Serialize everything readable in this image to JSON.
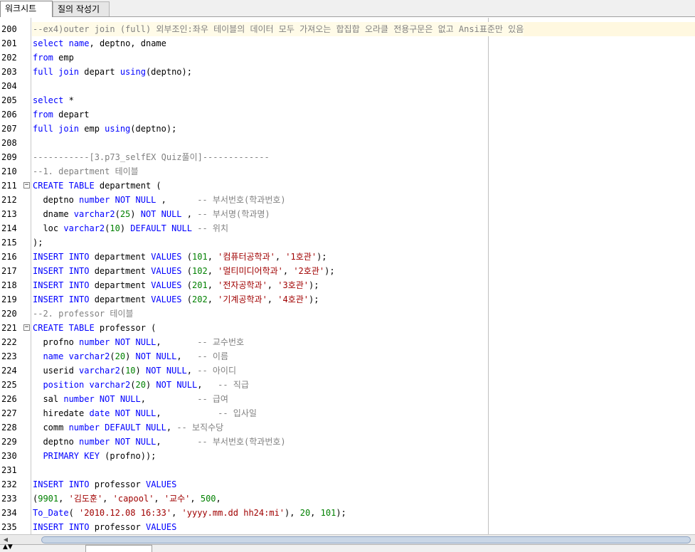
{
  "tabs": [
    {
      "label": "워크시트",
      "active": true
    },
    {
      "label": "질의 작성기",
      "active": false
    }
  ],
  "lines": [
    {
      "n": "200",
      "hl": true,
      "segs": [
        [
          "cm",
          "--ex4)outer join (full) 외부조인:좌우 테이블의 데이터 모두 가져오는 합집합 오라클 전용구문은 없고 Ansi표준만 있음"
        ]
      ]
    },
    {
      "n": "201",
      "segs": [
        [
          "kw",
          "select"
        ],
        [
          "",
          " "
        ],
        [
          "kw",
          "name"
        ],
        [
          "",
          ", deptno, dname"
        ]
      ]
    },
    {
      "n": "202",
      "segs": [
        [
          "kw",
          "from"
        ],
        [
          "",
          " emp"
        ]
      ]
    },
    {
      "n": "203",
      "segs": [
        [
          "kw",
          "full join"
        ],
        [
          "",
          " depart "
        ],
        [
          "kw",
          "using"
        ],
        [
          "",
          "(deptno);"
        ]
      ]
    },
    {
      "n": "204",
      "segs": []
    },
    {
      "n": "205",
      "segs": [
        [
          "kw",
          "select"
        ],
        [
          "",
          " *"
        ]
      ]
    },
    {
      "n": "206",
      "segs": [
        [
          "kw",
          "from"
        ],
        [
          "",
          " depart"
        ]
      ]
    },
    {
      "n": "207",
      "segs": [
        [
          "kw",
          "full join"
        ],
        [
          "",
          " emp "
        ],
        [
          "kw",
          "using"
        ],
        [
          "",
          "(deptno);"
        ]
      ]
    },
    {
      "n": "208",
      "segs": []
    },
    {
      "n": "209",
      "segs": [
        [
          "cm",
          "-----------[3.p73_selfEX Quiz풀이]-------------"
        ]
      ]
    },
    {
      "n": "210",
      "segs": [
        [
          "cm",
          "--1. department 테이블"
        ]
      ]
    },
    {
      "n": "211",
      "fold": true,
      "segs": [
        [
          "kw",
          "CREATE TABLE"
        ],
        [
          "",
          " department ("
        ]
      ]
    },
    {
      "n": "212",
      "segs": [
        [
          "",
          "  deptno "
        ],
        [
          "kw",
          "number NOT NULL"
        ],
        [
          "",
          " ,      "
        ],
        [
          "cm",
          "-- 부서번호(학과번호)"
        ]
      ]
    },
    {
      "n": "213",
      "segs": [
        [
          "",
          "  dname "
        ],
        [
          "kw",
          "varchar2"
        ],
        [
          "",
          "("
        ],
        [
          "num",
          "25"
        ],
        [
          "",
          ") "
        ],
        [
          "kw",
          "NOT NULL"
        ],
        [
          "",
          " , "
        ],
        [
          "cm",
          "-- 부서명(학과명)"
        ]
      ]
    },
    {
      "n": "214",
      "segs": [
        [
          "",
          "  loc "
        ],
        [
          "kw",
          "varchar2"
        ],
        [
          "",
          "("
        ],
        [
          "num",
          "10"
        ],
        [
          "",
          ") "
        ],
        [
          "kw",
          "DEFAULT NULL"
        ],
        [
          "",
          " "
        ],
        [
          "cm",
          "-- 위치"
        ]
      ]
    },
    {
      "n": "215",
      "segs": [
        [
          "",
          ");"
        ]
      ]
    },
    {
      "n": "216",
      "segs": [
        [
          "kw",
          "INSERT INTO"
        ],
        [
          "",
          " department "
        ],
        [
          "kw",
          "VALUES"
        ],
        [
          "",
          " ("
        ],
        [
          "num",
          "101"
        ],
        [
          "",
          ", "
        ],
        [
          "str",
          "'컴퓨터공학과'"
        ],
        [
          "",
          ", "
        ],
        [
          "str",
          "'1호관'"
        ],
        [
          "",
          ");"
        ]
      ]
    },
    {
      "n": "217",
      "segs": [
        [
          "kw",
          "INSERT INTO"
        ],
        [
          "",
          " department "
        ],
        [
          "kw",
          "VALUES"
        ],
        [
          "",
          " ("
        ],
        [
          "num",
          "102"
        ],
        [
          "",
          ", "
        ],
        [
          "str",
          "'멀티미디어학과'"
        ],
        [
          "",
          ", "
        ],
        [
          "str",
          "'2호관'"
        ],
        [
          "",
          ");"
        ]
      ]
    },
    {
      "n": "218",
      "segs": [
        [
          "kw",
          "INSERT INTO"
        ],
        [
          "",
          " department "
        ],
        [
          "kw",
          "VALUES"
        ],
        [
          "",
          " ("
        ],
        [
          "num",
          "201"
        ],
        [
          "",
          ", "
        ],
        [
          "str",
          "'전자공학과'"
        ],
        [
          "",
          ", "
        ],
        [
          "str",
          "'3호관'"
        ],
        [
          "",
          ");"
        ]
      ]
    },
    {
      "n": "219",
      "segs": [
        [
          "kw",
          "INSERT INTO"
        ],
        [
          "",
          " department "
        ],
        [
          "kw",
          "VALUES"
        ],
        [
          "",
          " ("
        ],
        [
          "num",
          "202"
        ],
        [
          "",
          ", "
        ],
        [
          "str",
          "'기계공학과'"
        ],
        [
          "",
          ", "
        ],
        [
          "str",
          "'4호관'"
        ],
        [
          "",
          ");"
        ]
      ]
    },
    {
      "n": "220",
      "segs": [
        [
          "cm",
          "--2. professor 테이블"
        ]
      ]
    },
    {
      "n": "221",
      "fold": true,
      "segs": [
        [
          "kw",
          "CREATE TABLE"
        ],
        [
          "",
          " professor ("
        ]
      ]
    },
    {
      "n": "222",
      "segs": [
        [
          "",
          "  profno "
        ],
        [
          "kw",
          "number NOT NULL"
        ],
        [
          "",
          ",       "
        ],
        [
          "cm",
          "-- 교수번호"
        ]
      ]
    },
    {
      "n": "223",
      "segs": [
        [
          "",
          "  "
        ],
        [
          "kw",
          "name"
        ],
        [
          "",
          " "
        ],
        [
          "kw",
          "varchar2"
        ],
        [
          "",
          "("
        ],
        [
          "num",
          "20"
        ],
        [
          "",
          ") "
        ],
        [
          "kw",
          "NOT NULL"
        ],
        [
          "",
          ",   "
        ],
        [
          "cm",
          "-- 이름"
        ]
      ]
    },
    {
      "n": "224",
      "segs": [
        [
          "",
          "  userid "
        ],
        [
          "kw",
          "varchar2"
        ],
        [
          "",
          "("
        ],
        [
          "num",
          "10"
        ],
        [
          "",
          ") "
        ],
        [
          "kw",
          "NOT NULL"
        ],
        [
          "",
          ", "
        ],
        [
          "cm",
          "-- 아이디"
        ]
      ]
    },
    {
      "n": "225",
      "segs": [
        [
          "",
          "  "
        ],
        [
          "kw",
          "position"
        ],
        [
          "",
          " "
        ],
        [
          "kw",
          "varchar2"
        ],
        [
          "",
          "("
        ],
        [
          "num",
          "20"
        ],
        [
          "",
          ") "
        ],
        [
          "kw",
          "NOT NULL"
        ],
        [
          "",
          ",   "
        ],
        [
          "cm",
          "-- 직급"
        ]
      ]
    },
    {
      "n": "226",
      "segs": [
        [
          "",
          "  sal "
        ],
        [
          "kw",
          "number NOT NULL"
        ],
        [
          "",
          ",          "
        ],
        [
          "cm",
          "-- 급여"
        ]
      ]
    },
    {
      "n": "227",
      "segs": [
        [
          "",
          "  hiredate "
        ],
        [
          "kw",
          "date NOT NULL"
        ],
        [
          "",
          ",           "
        ],
        [
          "cm",
          "-- 입사일"
        ]
      ]
    },
    {
      "n": "228",
      "segs": [
        [
          "",
          "  comm "
        ],
        [
          "kw",
          "number DEFAULT NULL"
        ],
        [
          "",
          ", "
        ],
        [
          "cm",
          "-- 보직수당"
        ]
      ]
    },
    {
      "n": "229",
      "segs": [
        [
          "",
          "  deptno "
        ],
        [
          "kw",
          "number NOT NULL"
        ],
        [
          "",
          ",       "
        ],
        [
          "cm",
          "-- 부서번호(학과번호)"
        ]
      ]
    },
    {
      "n": "230",
      "segs": [
        [
          "",
          "  "
        ],
        [
          "kw",
          "PRIMARY KEY"
        ],
        [
          "",
          " (profno));"
        ]
      ]
    },
    {
      "n": "231",
      "segs": []
    },
    {
      "n": "232",
      "segs": [
        [
          "kw",
          "INSERT INTO"
        ],
        [
          "",
          " professor "
        ],
        [
          "kw",
          "VALUES"
        ]
      ]
    },
    {
      "n": "233",
      "segs": [
        [
          "",
          "("
        ],
        [
          "num",
          "9901"
        ],
        [
          "",
          ", "
        ],
        [
          "str",
          "'김도훈'"
        ],
        [
          "",
          ", "
        ],
        [
          "str",
          "'capool'"
        ],
        [
          "",
          ", "
        ],
        [
          "str",
          "'교수'"
        ],
        [
          "",
          ", "
        ],
        [
          "num",
          "500"
        ],
        [
          "",
          ","
        ]
      ]
    },
    {
      "n": "234",
      "segs": [
        [
          "fn",
          "To_Date"
        ],
        [
          "",
          "( "
        ],
        [
          "str",
          "'2010.12.08 16:33'"
        ],
        [
          "",
          ", "
        ],
        [
          "str",
          "'yyyy.mm.dd hh24:mi'"
        ],
        [
          "",
          "), "
        ],
        [
          "num",
          "20"
        ],
        [
          "",
          ", "
        ],
        [
          "num",
          "101"
        ],
        [
          "",
          ");"
        ]
      ]
    },
    {
      "n": "235",
      "segs": [
        [
          "kw",
          "INSERT INTO"
        ],
        [
          "",
          " professor "
        ],
        [
          "kw",
          "VALUES"
        ]
      ]
    }
  ],
  "icons": {
    "fold": "fold-collapse-icon",
    "scroll_left": "scroll-left-icon",
    "scroll_right": "scroll-right-icon",
    "splitter": "splitter-arrows-icon"
  },
  "colors": {
    "keyword": "#0000ff",
    "comment": "#808080",
    "string": "#a00000",
    "number": "#008000",
    "highlight": "#fff8e0"
  }
}
